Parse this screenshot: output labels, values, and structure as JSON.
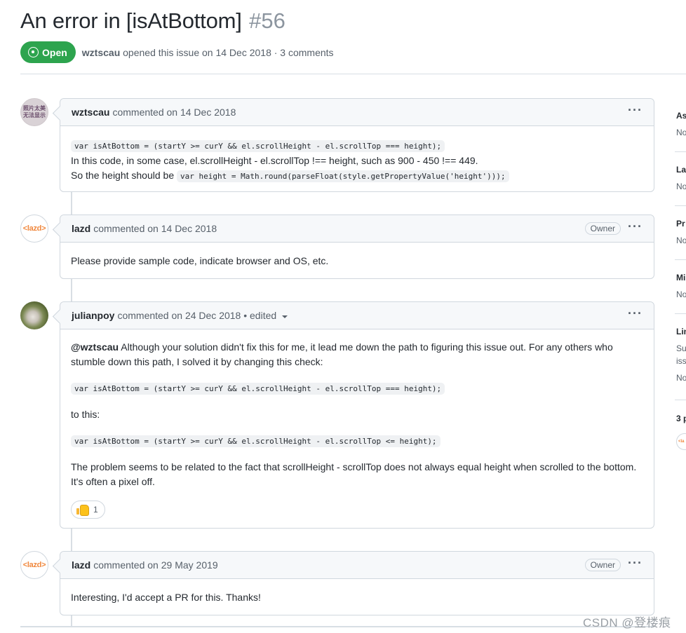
{
  "issue": {
    "title": "An error in [isAtBottom]",
    "number": "#56",
    "state": "Open",
    "author": "wztscau",
    "meta_suffix": "opened this issue on 14 Dec 2018 · 3 comments"
  },
  "comments": [
    {
      "author": "wztscau",
      "action": "commented on 14 Dec 2018",
      "avatar_text_line1": "照片太美",
      "avatar_text_line2": "无法显示",
      "code1": "var isAtBottom = (startY >= curY && el.scrollHeight - el.scrollTop === height);",
      "text1": "In this code, in some case, el.scrollHeight - el.scrollTop !== height, such as 900 - 450 !== 449.",
      "text2": "So the height should be",
      "code2": "var height = Math.round(parseFloat(style.getPropertyValue('height')));"
    },
    {
      "author": "lazd",
      "action": "commented on 14 Dec 2018",
      "badge": "Owner",
      "avatar_text": "<lazd>",
      "text1": "Please provide sample code, indicate browser and OS, etc."
    },
    {
      "author": "julianpoy",
      "action": "commented on 24 Dec 2018 • edited",
      "mention": "@wztscau",
      "text1": "Although your solution didn't fix this for me, it lead me down the path to figuring this issue out. For any others who stumble down this path, I solved it by changing this check:",
      "code1": "var isAtBottom = (startY >= curY && el.scrollHeight - el.scrollTop === height);",
      "text2": "to this:",
      "code2": "var isAtBottom = (startY >= curY && el.scrollHeight - el.scrollTop <= height);",
      "text3": "The problem seems to be related to the fact that scrollHeight - scrollTop does not always equal height when scrolled to the bottom. It's often a pixel off.",
      "reaction_count": "1",
      "reaction_icon": "thumbs-up-icon"
    },
    {
      "author": "lazd",
      "action": "commented on 29 May 2019",
      "badge": "Owner",
      "avatar_text": "<lazd>",
      "text1": "Interesting, I'd accept a PR for this. Thanks!"
    }
  ],
  "sidebar": {
    "sections": [
      {
        "head": "As",
        "value": "No"
      },
      {
        "head": "La",
        "value": "No"
      },
      {
        "head": "Pr",
        "value": "No"
      },
      {
        "head": "Mi",
        "value": "No"
      },
      {
        "head": "Lin",
        "value": "Su",
        "value2": "iss",
        "value3": "No"
      }
    ],
    "participants": "3 p",
    "participant_avatar": "<la"
  },
  "kebab_glyph": "···",
  "watermark": "CSDN @登楼痕",
  "colors": {
    "open_green": "#2da44e",
    "border": "#d0d7de",
    "header_bg": "#f6f8fa",
    "lazd_orange": "#f0883e"
  }
}
